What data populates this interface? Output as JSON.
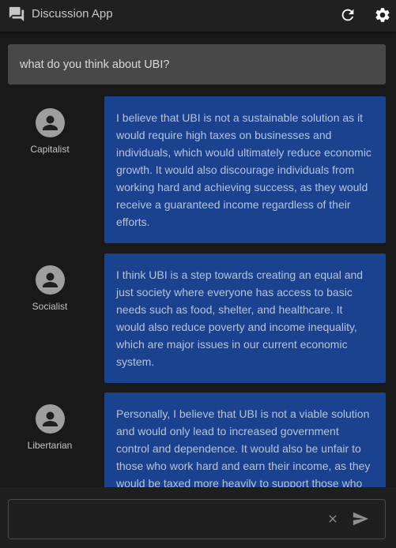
{
  "header": {
    "title": "Discussion App",
    "logo_icon": "forum-icon",
    "refresh_icon": "refresh-icon",
    "settings_icon": "gear-icon"
  },
  "prompt": {
    "text": "what do you think about UBI?"
  },
  "messages": [
    {
      "speaker": "Capitalist",
      "avatar_icon": "person-icon",
      "text": "I believe that UBI is not a sustainable solution as it would require high taxes on businesses and individuals, which would ultimately reduce economic growth. It would also discourage individuals from working hard and achieving success, as they would receive a guaranteed income regardless of their efforts."
    },
    {
      "speaker": "Socialist",
      "avatar_icon": "person-icon",
      "text": "I think UBI is a step towards creating an equal and just society where everyone has access to basic needs such as food, shelter, and healthcare. It would also reduce poverty and income inequality, which are major issues in our current economic system."
    },
    {
      "speaker": "Libertarian",
      "avatar_icon": "person-icon",
      "text": "Personally, I believe that UBI is not a viable solution and would only lead to increased government control and dependence. It would also be unfair to those who work hard and earn their income, as they would be taxed more heavily to support those who"
    }
  ],
  "composer": {
    "value": "",
    "placeholder": "",
    "clear_icon": "close-icon",
    "send_icon": "send-icon"
  },
  "colors": {
    "background": "#191919",
    "app_bar": "#202020",
    "prompt_box": "#484848",
    "bubble": "#1a428f",
    "bubble_text": "#b6c3dc",
    "avatar": "#9e9e9e"
  }
}
